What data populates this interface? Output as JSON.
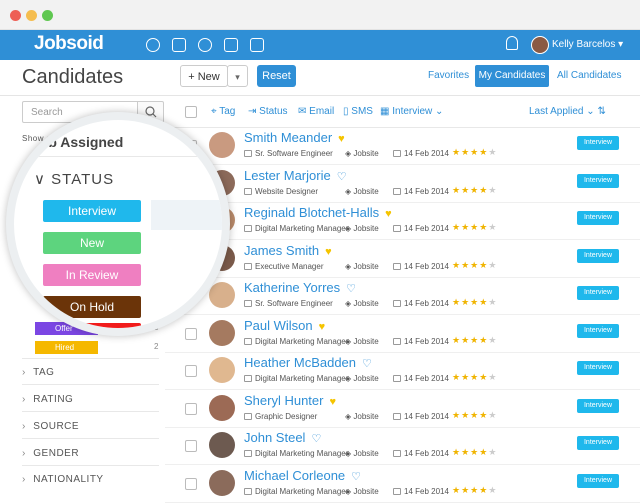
{
  "window": {
    "dots": [
      "#ee5f55",
      "#f5bd4f",
      "#5fc750"
    ]
  },
  "navbar": {
    "logo": "Jobsoid",
    "user": "Kelly Barcelos ▾",
    "color": "#2f8fd6"
  },
  "page": {
    "title": "Candidates",
    "new_label": "+ New",
    "caret": "▾",
    "reset_label": "Reset",
    "tabs": [
      "Favorites",
      "My Candidates",
      "All Candidates"
    ],
    "active_tab": "My Candidates"
  },
  "sidebar": {
    "search_placeholder": "Search",
    "show_label": "Show all Job Assigned",
    "filters": [
      "TAG",
      "RATING",
      "SOURCE",
      "GENDER",
      "NATIONALITY"
    ],
    "small_statuses": [
      {
        "label": "Offer",
        "count": "3",
        "color": "#7b46e3"
      },
      {
        "label": "Hired",
        "count": "2",
        "color": "#f5b800"
      }
    ]
  },
  "lens": {
    "job_label": "Job Assigned",
    "status_title": "STATUS",
    "statuses": [
      {
        "label": "Interview",
        "color": "#1fb8ec"
      },
      {
        "label": "New",
        "color": "#5dd47e"
      },
      {
        "label": "In Review",
        "color": "#ef7fc1"
      },
      {
        "label": "On Hold",
        "color": "#6b3409"
      },
      {
        "label": "Rejected",
        "color": "#f11b1b"
      }
    ]
  },
  "toolbar": {
    "tag": "Tag",
    "status": "Status",
    "email": "Email",
    "sms": "SMS",
    "interview": "Interview",
    "sort": "Last Applied"
  },
  "candidates": [
    {
      "name": "Smith Meander",
      "fav": true,
      "title": "Sr. Software Engineer",
      "source": "Jobsite",
      "date": "14 Feb 2014",
      "rating": 4,
      "status": "Interview",
      "face": "#c99a80"
    },
    {
      "name": "Lester Marjorie",
      "fav": false,
      "title": "Website Designer",
      "source": "Jobsite",
      "date": "14 Feb 2014",
      "rating": 4,
      "status": "Interview",
      "face": "#8c6a5a"
    },
    {
      "name": "Reginald Blotchet-Halls",
      "fav": true,
      "title": "Digital Marketing Manager",
      "source": "Jobsite",
      "date": "14 Feb 2014",
      "rating": 4,
      "status": "Interview",
      "face": "#b98a6a"
    },
    {
      "name": "James Smith",
      "fav": true,
      "title": "Executive Manager",
      "source": "Jobsite",
      "date": "14 Feb 2014",
      "rating": 4,
      "status": "Interview",
      "face": "#7a5a4a"
    },
    {
      "name": "Katherine Yorres",
      "fav": false,
      "title": "Sr. Software Engineer",
      "source": "Jobsite",
      "date": "14 Feb 2014",
      "rating": 4,
      "status": "Interview",
      "face": "#d8b08c"
    },
    {
      "name": "Paul Wilson",
      "fav": true,
      "title": "Digital Marketing Manager",
      "source": "Jobsite",
      "date": "14 Feb 2014",
      "rating": 4,
      "status": "Interview",
      "face": "#a57a60"
    },
    {
      "name": "Heather McBadden",
      "fav": false,
      "title": "Digital Marketing Manager",
      "source": "Jobsite",
      "date": "14 Feb 2014",
      "rating": 4,
      "status": "Interview",
      "face": "#e0b890"
    },
    {
      "name": "Sheryl Hunter",
      "fav": true,
      "title": "Graphic Designer",
      "source": "Jobsite",
      "date": "14 Feb 2014",
      "rating": 4,
      "status": "Interview",
      "face": "#9c6a55"
    },
    {
      "name": "John Steel",
      "fav": false,
      "title": "Digital Marketing Manager",
      "source": "Jobsite",
      "date": "14 Feb 2014",
      "rating": 4,
      "status": "Interview",
      "face": "#6d5a50"
    },
    {
      "name": "Michael Corleone",
      "fav": false,
      "title": "Digital Marketing Manager",
      "source": "Jobsite",
      "date": "14 Feb 2014",
      "rating": 4,
      "status": "Interview",
      "face": "#8b6b5b"
    }
  ]
}
